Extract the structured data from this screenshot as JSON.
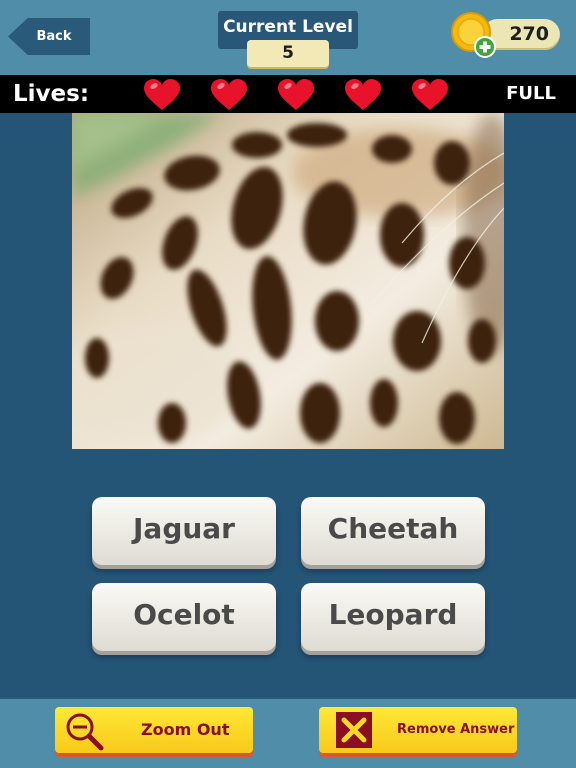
{
  "header": {
    "back_label": "Back",
    "level_title": "Current Level",
    "level_value": "5",
    "coins": "270",
    "coin_icon": "coin-plus-icon"
  },
  "lives": {
    "label": "Lives:",
    "count": 5,
    "max": 5,
    "status": "FULL",
    "heart_color": "#e8132a"
  },
  "puzzle": {
    "image": "leopard-spotted-fur-closeup"
  },
  "answers": [
    {
      "label": "Jaguar"
    },
    {
      "label": "Cheetah"
    },
    {
      "label": "Ocelot"
    },
    {
      "label": "Leopard"
    }
  ],
  "tools": {
    "zoom_out": {
      "label": "Zoom Out",
      "icon": "magnifier-minus-icon"
    },
    "remove_answer": {
      "label": "Remove Answer",
      "icon": "cross-icon"
    }
  },
  "colors": {
    "background": "#245476",
    "bar": "#4f8da8",
    "button_yellow": "#f9d923",
    "tool_text": "#8a0f21"
  }
}
